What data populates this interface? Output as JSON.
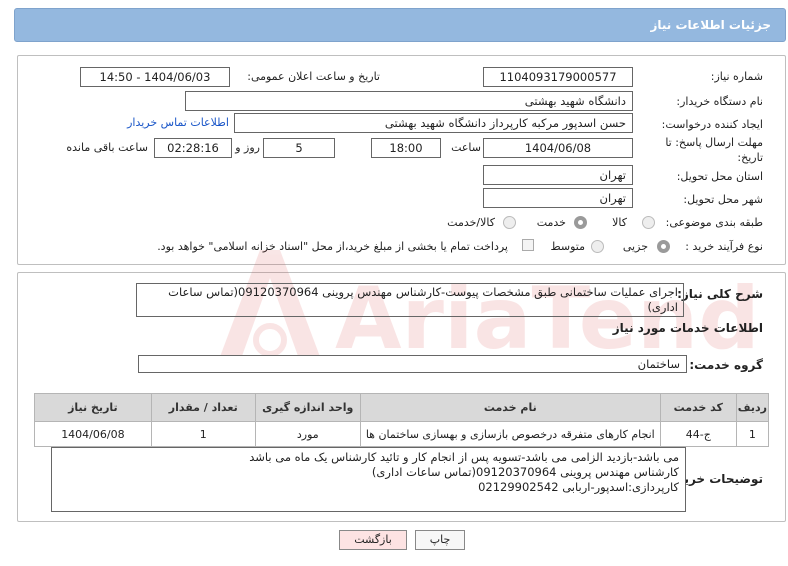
{
  "header": {
    "title": "جزئیات اطلاعات نیاز"
  },
  "form": {
    "need_number_label": "شماره نیاز:",
    "need_number": "1104093179000577",
    "announce_label": "تاریخ و ساعت اعلان عمومی:",
    "announce_value": "1404/06/03 - 14:50",
    "buyer_org_label": "نام دستگاه خریدار:",
    "buyer_org": "دانشگاه شهید بهشتی",
    "creator_label": "ایجاد کننده درخواست:",
    "creator": "حسن اسدپور مرکبه کارپرداز دانشگاه شهید بهشتی",
    "contact_link": "اطلاعات تماس خریدار",
    "deadline_label_1": "مهلت ارسال پاسخ: تا",
    "deadline_label_2": "تاریخ:",
    "deadline_date": "1404/06/08",
    "time_label": "ساعت",
    "deadline_time": "18:00",
    "days_value": "5",
    "days_label": "روز و",
    "remaining_time": "02:28:16",
    "remaining_label": "ساعت باقی مانده",
    "province_label": "استان محل تحویل:",
    "province": "تهران",
    "city_label": "شهر محل تحویل:",
    "city": "تهران",
    "category_label": "طبقه بندی موضوعی:",
    "category_options": [
      "کالا",
      "خدمت",
      "کالا/خدمت"
    ],
    "category_selected": "خدمت",
    "process_label": "نوع فرآیند خرید :",
    "process_options": [
      "جزیی",
      "متوسط"
    ],
    "process_selected": "جزیی",
    "payment_note": "پرداخت تمام یا بخشی از مبلغ خرید،از محل \"اسناد خزانه اسلامی\" خواهد بود."
  },
  "summary": {
    "label": "شرح کلی نیاز:",
    "text": "اجرای عملیات ساختمانی طبق مشخصات پیوست-کارشناس مهندس پروینی 09120370964(تماس ساعات اداری)"
  },
  "services": {
    "section_title": "اطلاعات خدمات مورد نیاز",
    "group_label": "گروه خدمت:",
    "group_value": "ساختمان",
    "columns": [
      "ردیف",
      "کد خدمت",
      "نام خدمت",
      "واحد اندازه گیری",
      "تعداد / مقدار",
      "تاریخ نیاز"
    ],
    "rows": [
      [
        "1",
        "ج-44",
        "انجام کارهای متفرقه درخصوص بازسازی و بهسازی ساختمان ها",
        "مورد",
        "1",
        "1404/06/08"
      ]
    ]
  },
  "buyer_notes": {
    "label": "توضیحات خریدار:",
    "lines": [
      "می باشد-بازدید الزامی می باشد-تسویه پس از انجام کار و تائید کارشناس یک ماه می باشد",
      "کارشناس مهندس پروینی 09120370964(تماس ساعات اداری)",
      "کارپردازی:اسدپور-اربابی 02129902542"
    ]
  },
  "buttons": {
    "print": "چاپ",
    "back": "بازگشت"
  },
  "watermark": {
    "text": "AriaTender.neT"
  },
  "colors": {
    "header_bg": "#94b8df",
    "link": "#1a56c8",
    "table_header": "#d9d9d9",
    "back_button": "#fde3e3",
    "watermark": "#d23a3a"
  }
}
